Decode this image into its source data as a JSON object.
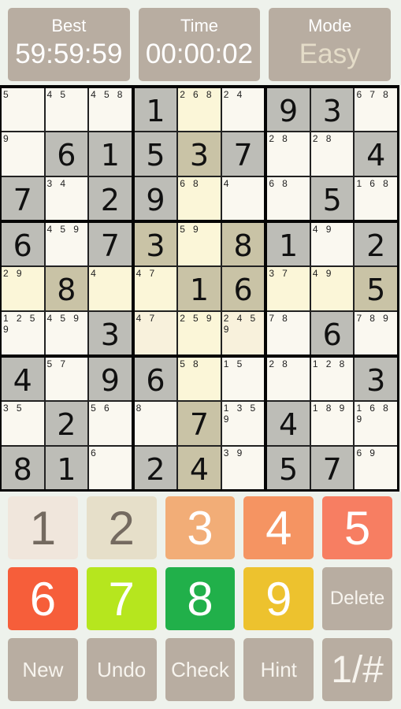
{
  "stats": {
    "best": {
      "label": "Best",
      "value": "59:59:59"
    },
    "time": {
      "label": "Time",
      "value": "00:00:02"
    },
    "mode": {
      "label": "Mode",
      "value": "Easy"
    }
  },
  "board": {
    "selected": [
      5,
      5
    ],
    "rows": [
      [
        [
          "5"
        ],
        [
          "4",
          "5"
        ],
        [
          "4",
          "5",
          "8"
        ],
        "1",
        [
          "2",
          "6",
          "8"
        ],
        [
          "2",
          "4"
        ],
        "9",
        "3",
        [
          "6",
          "7",
          "8"
        ]
      ],
      [
        [
          "9"
        ],
        "6",
        "1",
        "5",
        "3",
        "7",
        [
          "2",
          "8"
        ],
        [
          "2",
          "8"
        ],
        "4"
      ],
      [
        "7",
        [
          "3",
          "4"
        ],
        "2",
        "9",
        [
          "6",
          "8"
        ],
        [
          "4"
        ],
        [
          "6",
          "8"
        ],
        "5",
        [
          "1",
          "6",
          "8"
        ]
      ],
      [
        "6",
        [
          "4",
          "5",
          "9"
        ],
        "7",
        "3",
        [
          "5",
          "9"
        ],
        "8",
        "1",
        [
          "4",
          "9"
        ],
        "2"
      ],
      [
        [
          "2",
          "9"
        ],
        "8",
        [
          "4"
        ],
        [
          "4",
          "7"
        ],
        "1",
        "6",
        [
          "3",
          "7"
        ],
        [
          "4",
          "9"
        ],
        "5"
      ],
      [
        [
          "1",
          "2",
          "5",
          "9"
        ],
        [
          "4",
          "5",
          "9"
        ],
        "3",
        [
          "4",
          "7"
        ],
        [
          "2",
          "5",
          "9"
        ],
        [
          "2",
          "4",
          "5",
          "9"
        ],
        [
          "7",
          "8"
        ],
        "6",
        [
          "7",
          "8",
          "9"
        ]
      ],
      [
        "4",
        [
          "5",
          "7"
        ],
        "9",
        "6",
        [
          "5",
          "8"
        ],
        [
          "1",
          "5"
        ],
        [
          "2",
          "8"
        ],
        [
          "1",
          "2",
          "8"
        ],
        "3"
      ],
      [
        [
          "3",
          "5"
        ],
        "2",
        [
          "5",
          "6"
        ],
        [
          "8"
        ],
        "7",
        [
          "1",
          "3",
          "5",
          "9"
        ],
        "4",
        [
          "1",
          "8",
          "9"
        ],
        [
          "1",
          "6",
          "8",
          "9"
        ]
      ],
      [
        "8",
        "1",
        [
          "6"
        ],
        "2",
        "4",
        [
          "3",
          "9"
        ],
        "5",
        "7",
        [
          "6",
          "9"
        ]
      ]
    ]
  },
  "keypad": {
    "digits": [
      {
        "label": "1",
        "bg": "#f0e6dc",
        "fg": "#746a60"
      },
      {
        "label": "2",
        "bg": "#e6dfc9",
        "fg": "#746a60"
      },
      {
        "label": "3",
        "bg": "#f2ad77",
        "fg": "#ffffff"
      },
      {
        "label": "4",
        "bg": "#f59462",
        "fg": "#ffffff"
      },
      {
        "label": "5",
        "bg": "#f77e62",
        "fg": "#ffffff"
      },
      {
        "label": "6",
        "bg": "#f65e3a",
        "fg": "#ffffff"
      },
      {
        "label": "7",
        "bg": "#b6e61e",
        "fg": "#ffffff"
      },
      {
        "label": "8",
        "bg": "#21b04a",
        "fg": "#ffffff"
      },
      {
        "label": "9",
        "bg": "#edc22e",
        "fg": "#ffffff"
      }
    ],
    "delete": "Delete",
    "new": "New",
    "undo": "Undo",
    "check": "Check",
    "hint": "Hint",
    "toggle": "1/#"
  }
}
